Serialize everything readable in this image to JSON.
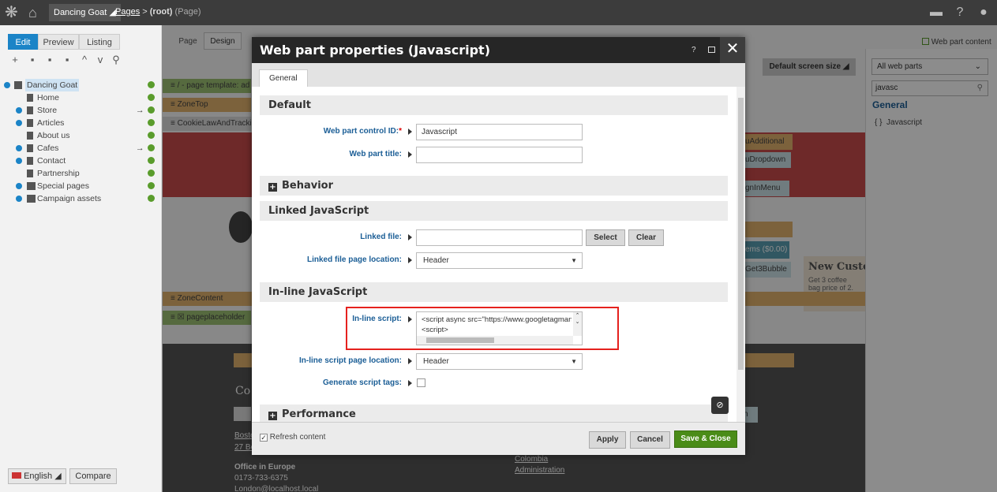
{
  "topbar": {
    "site": "Dancing Goat",
    "crumb_pages": "Pages",
    "crumb_sep": ">",
    "crumb_root": "(root)",
    "crumb_page": "(Page)"
  },
  "left": {
    "modes": [
      "Edit",
      "Preview",
      "Listing"
    ],
    "tree": [
      {
        "label": "Dancing Goat",
        "root": true
      },
      {
        "label": "Home"
      },
      {
        "label": "Store",
        "arrow": true
      },
      {
        "label": "Articles"
      },
      {
        "label": "About us"
      },
      {
        "label": "Cafes",
        "arrow": true
      },
      {
        "label": "Contact"
      },
      {
        "label": "Partnership"
      },
      {
        "label": "Special pages"
      },
      {
        "label": "Campaign assets"
      }
    ],
    "language": "English",
    "compare": "Compare"
  },
  "design_tabs": [
    "Page",
    "Design"
  ],
  "canvas": {
    "page_template": "/ - page template: ad",
    "zone_top": "ZoneTop",
    "cookie": "CookieLawAndTrackin",
    "zone_content": "ZoneContent",
    "placeholder": "pageplaceholder",
    "bg_frag": [
      "uAdditional",
      "uDropdown",
      "gnInMenu",
      "ems ($0.00)",
      "Get3Bubble",
      "n"
    ],
    "promo_title": "New Custo",
    "promo_text": "Get 3 coffee bag price of 2.",
    "footer_left": [
      "Boste",
      "27 Bc",
      "Office in Europe",
      "0173-733-6375",
      "London@localhost.local"
    ],
    "footer_mid": [
      "Colombia",
      "Administration"
    ],
    "footer_co": "Co"
  },
  "canvas_toolbar": {
    "screen_size": "Default screen size",
    "web_part_content": "Web part content"
  },
  "right_panel": {
    "filter": "All web parts",
    "search_value": "javasc",
    "category": "General",
    "item": "{ }  Javascript"
  },
  "modal": {
    "title": "Web part properties (Javascript)",
    "help": "?",
    "tab": "General",
    "sections": {
      "default": "Default",
      "behavior": "Behavior",
      "linked": "Linked JavaScript",
      "inline": "In-line JavaScript",
      "performance": "Performance"
    },
    "fields": {
      "control_id_label": "Web part control ID:",
      "control_id_value": "Javascript",
      "title_label": "Web part title:",
      "title_value": "",
      "linked_file_label": "Linked file:",
      "linked_file_value": "",
      "select": "Select",
      "clear": "Clear",
      "linked_location_label": "Linked file page location:",
      "linked_location_value": "Header",
      "inline_script_label": "In-line script:",
      "inline_script_line1": "<script async src=\"https://www.googletagmana",
      "inline_script_line2": "<script>",
      "inline_location_label": "In-line script page location:",
      "inline_location_value": "Header",
      "generate_tags_label": "Generate script tags:"
    },
    "footer": {
      "refresh": "Refresh content",
      "apply": "Apply",
      "cancel": "Cancel",
      "save_close": "Save & Close"
    }
  },
  "colors": {
    "topbar": "#3c3c3c",
    "accent_blue": "#1b84c7",
    "save_green": "#4a8c18",
    "highlight_red": "#e5211e",
    "zone_orange": "#e2b36d",
    "zone_green": "#9dc173",
    "zone_red": "#c84c4c"
  }
}
